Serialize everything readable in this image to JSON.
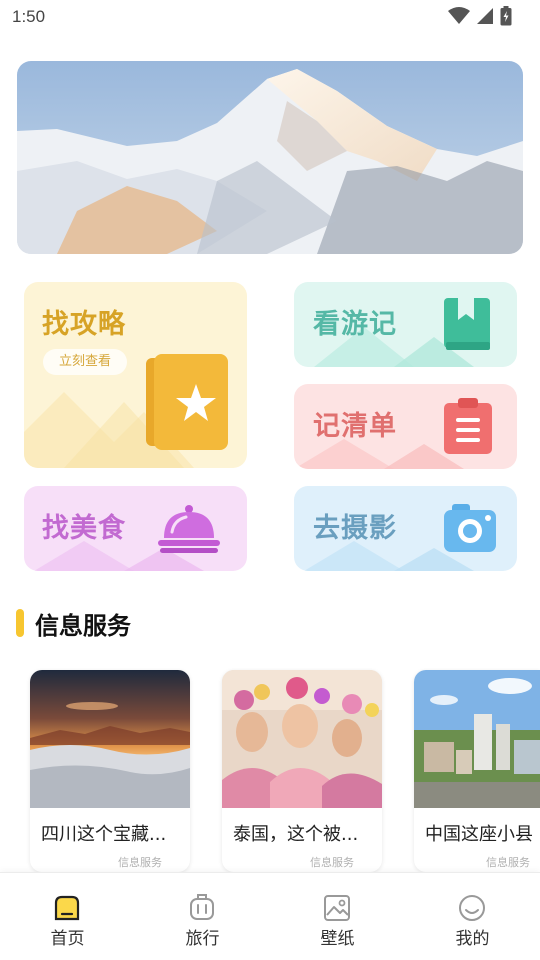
{
  "status_bar": {
    "time": "1:50",
    "icons": [
      "wifi-icon",
      "signal-icon",
      "battery-icon"
    ]
  },
  "banner": {
    "image": "snowy-mountain-photo"
  },
  "cards": {
    "guide": {
      "title": "找攻略",
      "button": "立刻查看",
      "icon": "starred-book-icon",
      "color": "#d7a326"
    },
    "travel": {
      "title": "看游记",
      "icon": "bookmark-book-icon",
      "color": "#55b8a6"
    },
    "list": {
      "title": "记清单",
      "icon": "clipboard-icon",
      "color": "#e0706f"
    },
    "food": {
      "title": "找美食",
      "icon": "food-cloche-icon",
      "color": "#c26ad1"
    },
    "photo": {
      "title": "去摄影",
      "icon": "camera-icon",
      "color": "#6a9fbf"
    }
  },
  "section": {
    "title": "信息服务",
    "accent": "#f7c630"
  },
  "info_items": [
    {
      "title": "四川这个宝藏...",
      "tag": "信息服务",
      "image": "sunset-sea-of-clouds-photo"
    },
    {
      "title": "泰国，这个被...",
      "tag": "信息服务",
      "image": "thai-women-festival-photo"
    },
    {
      "title": "中国这座小县",
      "tag": "信息服务",
      "image": "city-buildings-photo"
    }
  ],
  "tabs": [
    {
      "label": "首页",
      "icon": "home-icon",
      "active": true
    },
    {
      "label": "旅行",
      "icon": "luggage-icon",
      "active": false
    },
    {
      "label": "壁纸",
      "icon": "image-icon",
      "active": false
    },
    {
      "label": "我的",
      "icon": "smile-icon",
      "active": false
    }
  ]
}
